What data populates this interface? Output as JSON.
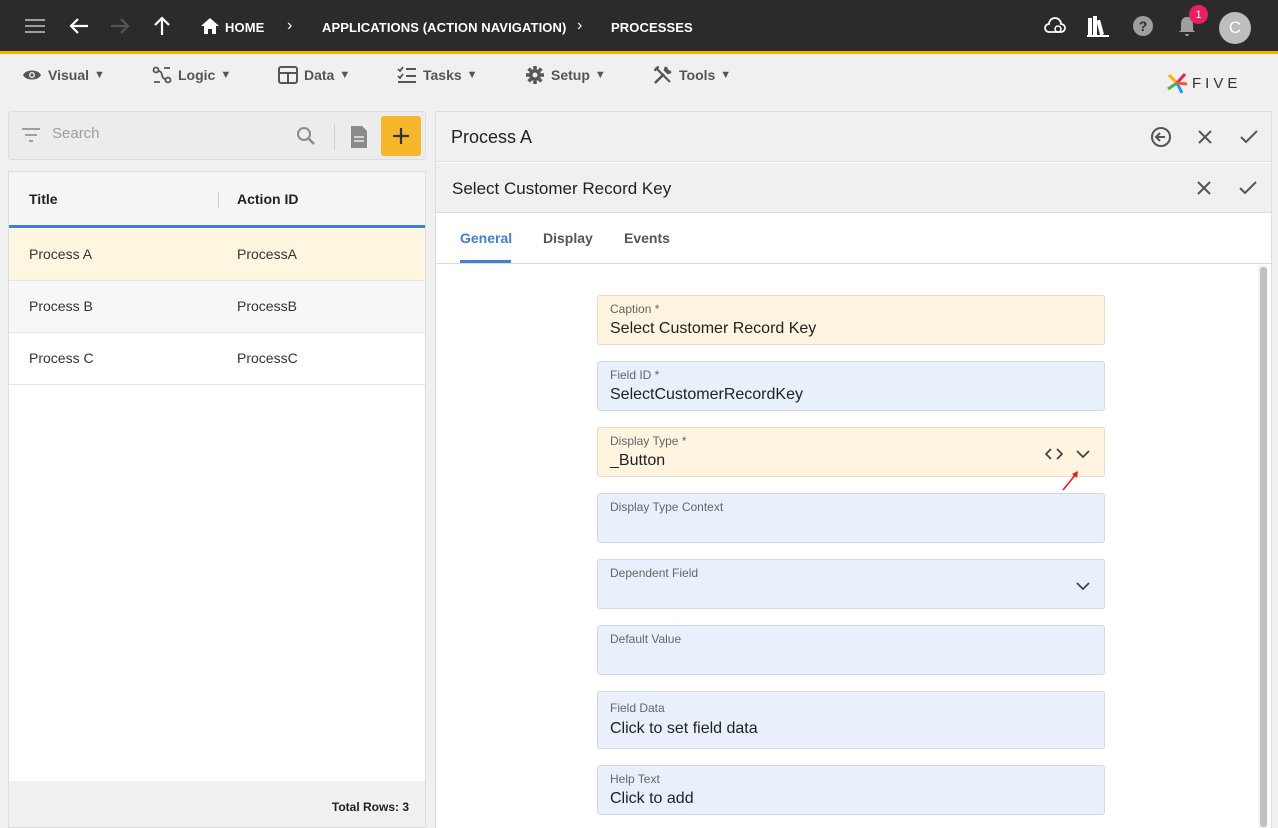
{
  "topbar": {
    "breadcrumbs": [
      "HOME",
      "APPLICATIONS (ACTION NAVIGATION)",
      "PROCESSES"
    ],
    "notification_count": "1",
    "avatar_initial": "C"
  },
  "menubar": {
    "items": [
      "Visual",
      "Logic",
      "Data",
      "Tasks",
      "Setup",
      "Tools"
    ],
    "caret": "▼",
    "logo_text": "FIVE"
  },
  "search": {
    "placeholder": "Search"
  },
  "list": {
    "columns": [
      "Title",
      "Action ID"
    ],
    "rows": [
      {
        "title": "Process A",
        "action_id": "ProcessA"
      },
      {
        "title": "Process B",
        "action_id": "ProcessB"
      },
      {
        "title": "Process C",
        "action_id": "ProcessC"
      }
    ],
    "footer": "Total Rows: 3"
  },
  "panel": {
    "title": "Process A",
    "subtitle": "Select Customer Record Key",
    "tabs": [
      "General",
      "Display",
      "Events"
    ],
    "active_tab": "General"
  },
  "form": {
    "fields": [
      {
        "label": "Caption *",
        "value": "Select Customer Record Key"
      },
      {
        "label": "Field ID *",
        "value": "SelectCustomerRecordKey"
      },
      {
        "label": "Display Type *",
        "value": "_Button"
      },
      {
        "label": "Display Type Context",
        "value": ""
      },
      {
        "label": "Dependent Field",
        "value": ""
      },
      {
        "label": "Default Value",
        "value": ""
      },
      {
        "label": "Field Data",
        "value": "Click to set field data"
      },
      {
        "label": "Help Text",
        "value": "Click to add"
      }
    ]
  },
  "colors": {
    "accent": "#3f7fd4",
    "add_button": "#f6b72c",
    "topbar": "#2b2b2b",
    "selected_row": "#fff6e0",
    "warn_field": "#fef4e0",
    "field": "#e8f0fb"
  }
}
